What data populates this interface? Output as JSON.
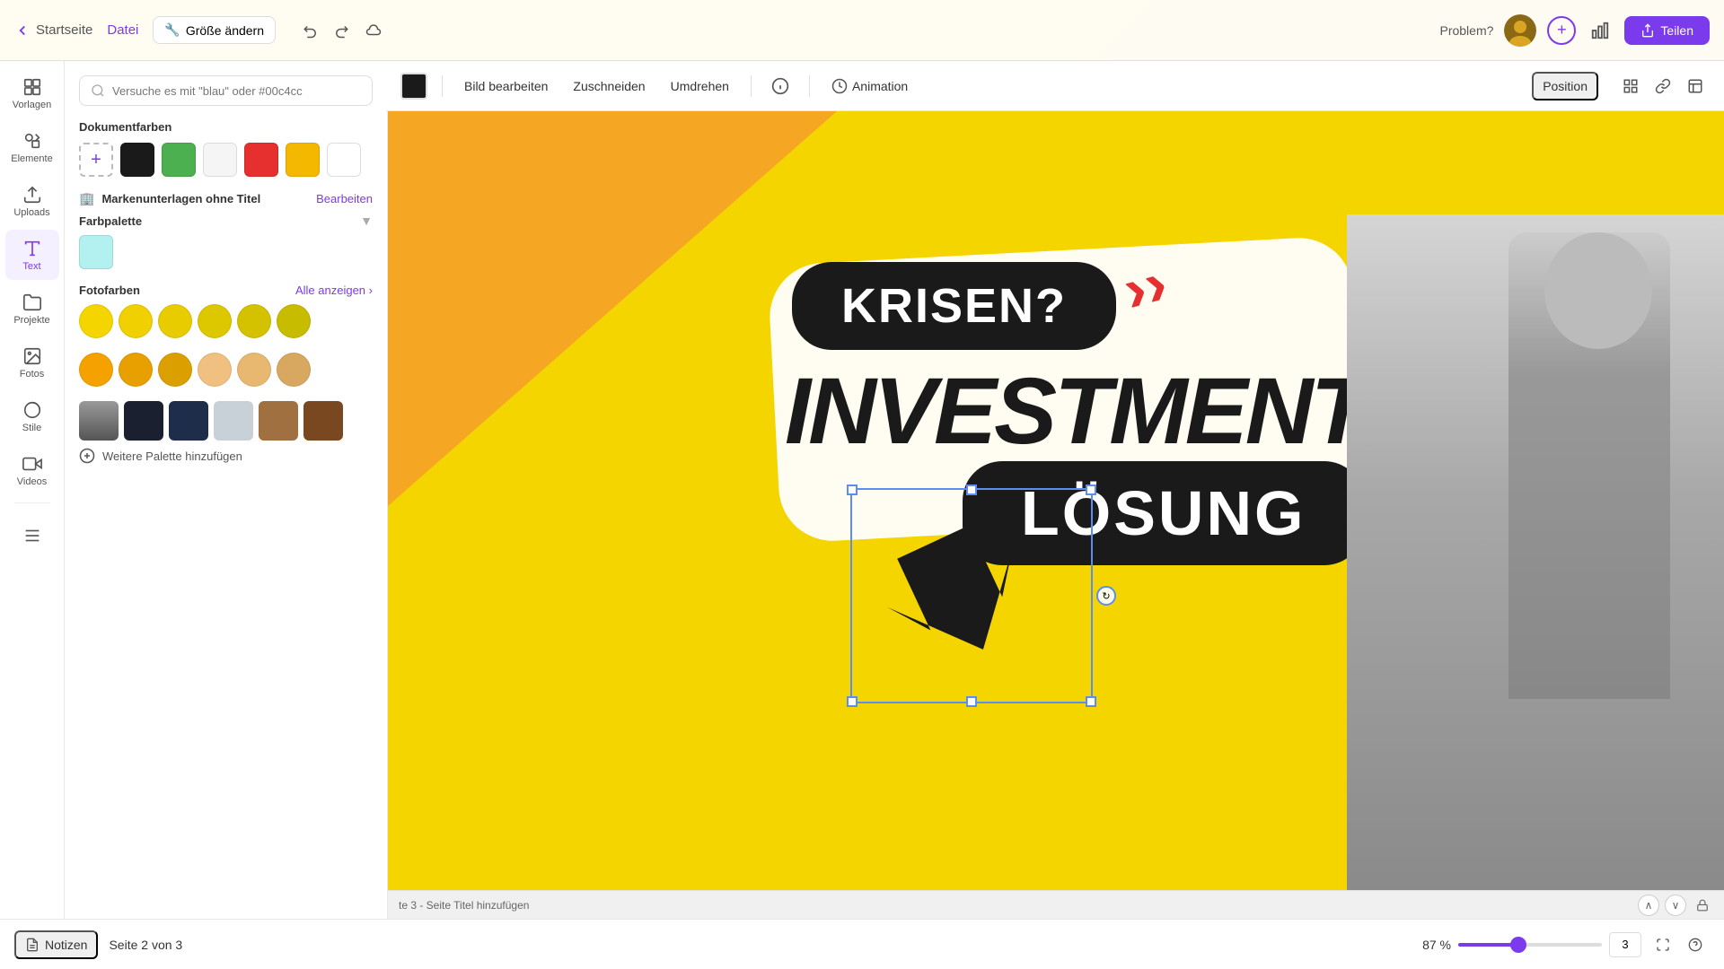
{
  "topbar": {
    "home_label": "Startseite",
    "file_label": "Datei",
    "resize_label": "Größe ändern",
    "problem_label": "Problem?",
    "share_label": "Teilen"
  },
  "secondary_toolbar": {
    "edit_image": "Bild bearbeiten",
    "crop": "Zuschneiden",
    "flip": "Umdrehen",
    "animation": "Animation",
    "position": "Position"
  },
  "sidebar": {
    "items": [
      {
        "label": "Vorlagen",
        "icon": "grid-icon"
      },
      {
        "label": "Elemente",
        "icon": "elements-icon"
      },
      {
        "label": "Uploads",
        "icon": "upload-icon"
      },
      {
        "label": "Text",
        "icon": "text-icon"
      },
      {
        "label": "Projekte",
        "icon": "folder-icon"
      },
      {
        "label": "Fotos",
        "icon": "photo-icon"
      },
      {
        "label": "Stile",
        "icon": "style-icon"
      },
      {
        "label": "Videos",
        "icon": "video-icon"
      }
    ]
  },
  "color_panel": {
    "search_placeholder": "Versuche es mit \"blau\" oder #00c4cc",
    "doc_colors_label": "Dokumentfarben",
    "brand_label": "Markenunterlagen ohne Titel",
    "edit_label": "Bearbeiten",
    "palette_label": "Farbpalette",
    "foto_colors_label": "Fotofarben",
    "all_label": "Alle anzeigen",
    "more_palette_label": "Weitere Palette hinzufügen",
    "doc_colors": [
      "#7c3aed_add",
      "#1a1a1a",
      "#4caf50",
      "#f5f5f5",
      "#e63030",
      "#f5b800",
      "#ffffff"
    ],
    "palette_color": "#b3f0f0",
    "foto_colors_row1": [
      "#f5d500",
      "#f0d000",
      "#e8cc00",
      "#ddc800",
      "#d4c200",
      "#c8bc00"
    ],
    "foto_colors_row2": [
      "#f5a200",
      "#e8a000",
      "#dba000",
      "#f0c080",
      "#e8b870",
      "#d8a860"
    ],
    "foto_thumbs": [
      "person",
      "dark1",
      "dark2",
      "light1",
      "brown1",
      "brown2"
    ]
  },
  "canvas": {
    "headline1": "KRISEN?",
    "headline2": "INVESTMENT",
    "headline3": "LÖSUNG"
  },
  "bottom_bar": {
    "notes_label": "Notizen",
    "page_label": "Seite 2 von 3",
    "zoom_label": "87 %",
    "page_title": "te 3 - Seite Titel hinzufügen",
    "page_num": "3"
  }
}
